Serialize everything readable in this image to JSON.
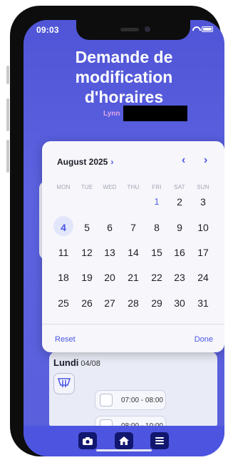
{
  "status": {
    "time": "09:03"
  },
  "header": {
    "title_line1": "Demande de",
    "title_line2": "modification",
    "title_line3": "d'horaires",
    "user_name": "Lynn"
  },
  "calendar": {
    "month_label": "August 2025",
    "weekdays": [
      "MON",
      "TUE",
      "WED",
      "THU",
      "FRI",
      "SAT",
      "SUN"
    ],
    "weeks": [
      [
        "",
        "",
        "",
        "",
        "1",
        "2",
        "3"
      ],
      [
        "4",
        "5",
        "6",
        "7",
        "8",
        "9",
        "10"
      ],
      [
        "11",
        "12",
        "13",
        "14",
        "15",
        "16",
        "17"
      ],
      [
        "18",
        "19",
        "20",
        "21",
        "22",
        "23",
        "24"
      ],
      [
        "25",
        "26",
        "27",
        "28",
        "29",
        "30",
        "31"
      ]
    ],
    "selected_day": "4",
    "accent_day": "1",
    "reset_label": "Reset",
    "done_label": "Done"
  },
  "day_card": {
    "day_name": "Lundi",
    "day_date": "04/08",
    "slots": [
      "07:00 - 08:00",
      "08:00 - 10:00"
    ]
  },
  "tabs": [
    {
      "icon": "camera-icon"
    },
    {
      "icon": "home-icon"
    },
    {
      "icon": "menu-icon"
    }
  ],
  "colors": {
    "primary": "#5a5fd9",
    "accent": "#4c56e6",
    "tab_icon_bg": "#11176e"
  }
}
